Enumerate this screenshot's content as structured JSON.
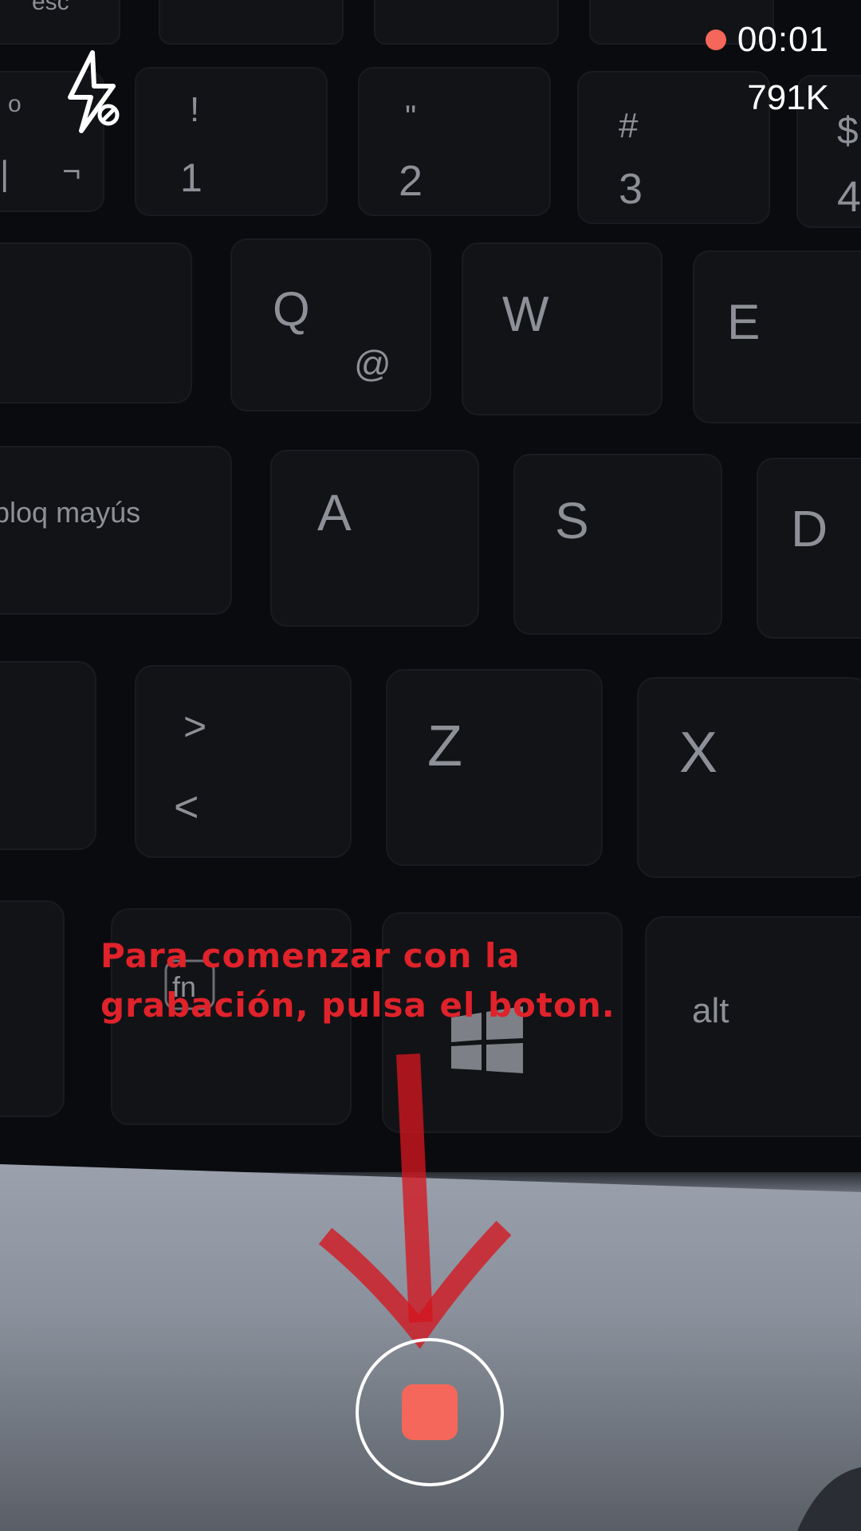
{
  "recording": {
    "elapsed": "00:01",
    "file_size": "791K",
    "indicator_color": "#f4675a"
  },
  "annotation": {
    "line1": "Para comenzar con la",
    "line2": "grabación, pulsa el boton.",
    "color": "#e0222a"
  },
  "keyboard_keys": {
    "esc": "esc",
    "exclaim": "!",
    "one": "1",
    "quote": "\"",
    "two": "2",
    "hash": "#",
    "three": "3",
    "dollar": "$",
    "four": "4",
    "o": "o",
    "not": "¬",
    "bar": "|",
    "q": "Q",
    "at": "@",
    "w": "W",
    "e": "E",
    "caps": "bloq mayús",
    "a": "A",
    "s": "S",
    "d": "D",
    "gt": ">",
    "lt": "<",
    "z": "Z",
    "x": "X",
    "fn": "fn",
    "alt": "alt"
  },
  "icons": {
    "flash": "flash-off-icon",
    "record": "stop-icon"
  }
}
